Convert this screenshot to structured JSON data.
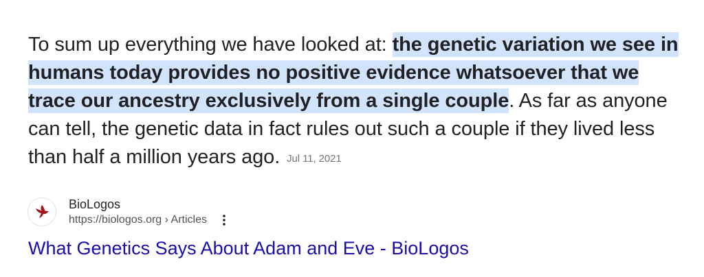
{
  "snippet": {
    "lead_text": "To sum up everything we have looked at: ",
    "highlighted_text": "the genetic variation we see in humans today provides no positive evidence whatsoever that we trace our ancestry exclusively from a single couple",
    "trailing_text": ". As far as anyone can tell, the genetic data in fact rules out such a couple if they lived less than half a million years ago.",
    "date": "Jul 11, 2021"
  },
  "source": {
    "site_name": "BioLogos",
    "url": "https://biologos.org › Articles",
    "favicon_icon": "dove-icon",
    "favicon_color": "#a3161d",
    "menu_icon": "more-vert-icon"
  },
  "result": {
    "title": "What Genetics Says About Adam and Eve - BioLogos",
    "link_color": "#1a0dab"
  }
}
